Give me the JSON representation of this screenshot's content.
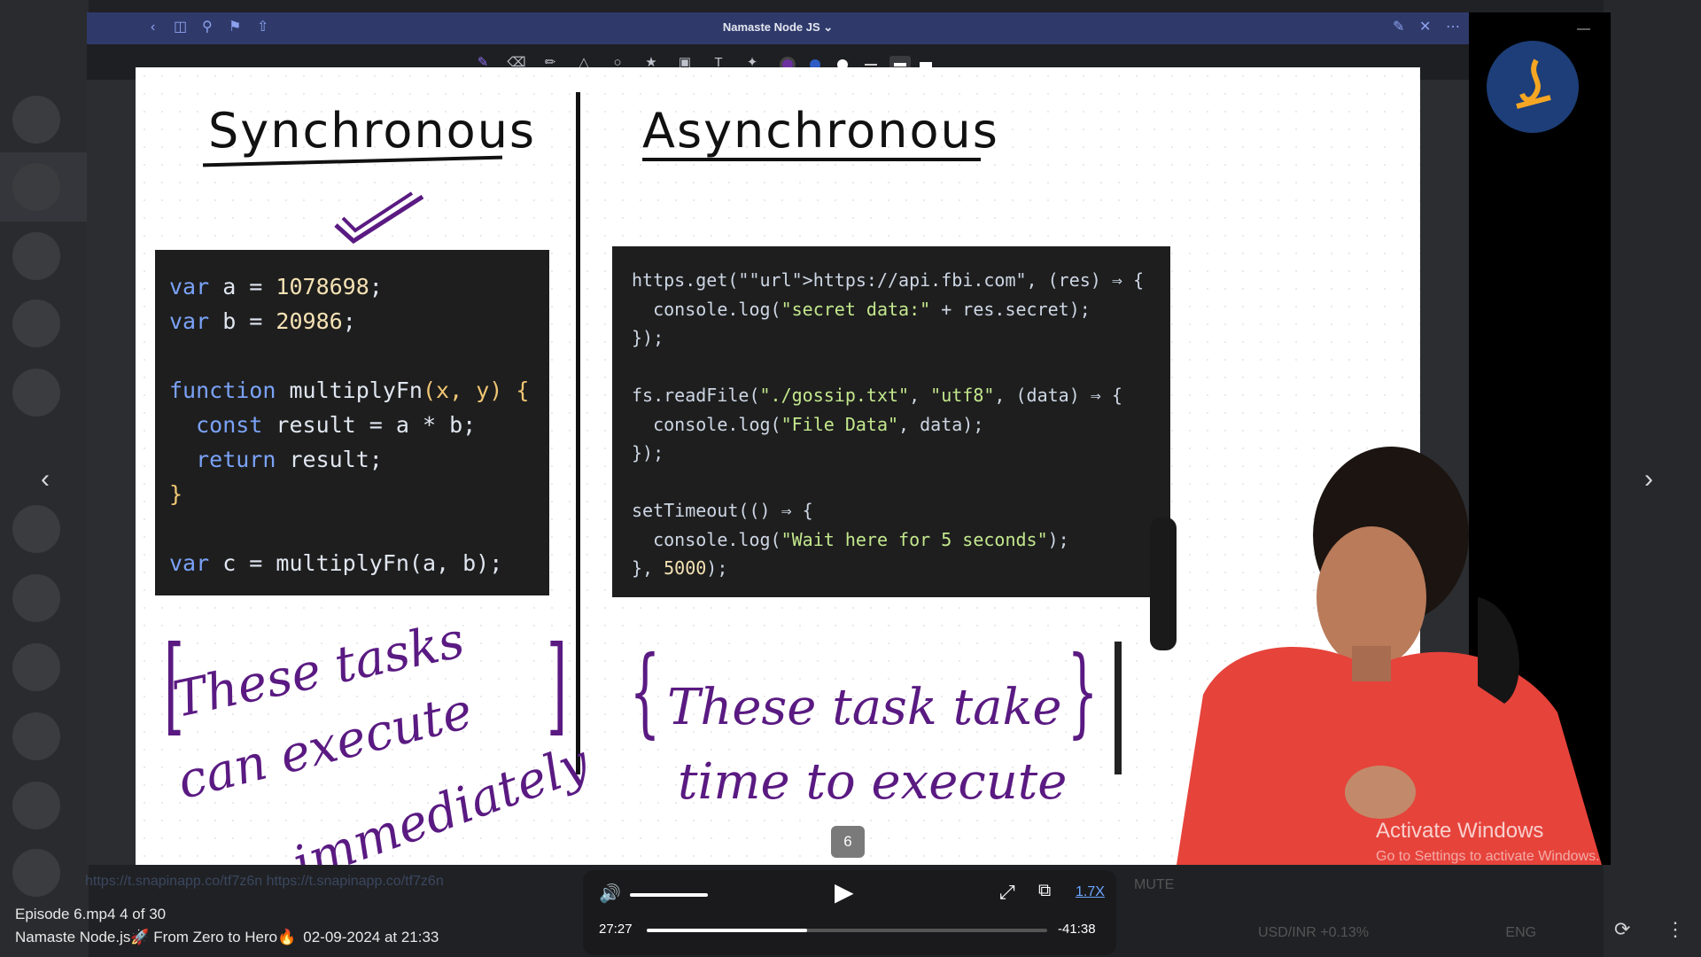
{
  "notes_app": {
    "title": "Namaste Node JS ⌄"
  },
  "slide": {
    "left_heading": "Synchronous",
    "right_heading": "Asynchronous",
    "sync_code": [
      [
        "var",
        " a = ",
        "1078698",
        ";"
      ],
      [
        "var",
        " b = ",
        "20986",
        ";"
      ],
      [
        "",
        "",
        "",
        ""
      ],
      [
        "function",
        " multiplyFn",
        "(x, y) {",
        ""
      ],
      [
        "  const",
        " result = a * b;",
        "",
        ""
      ],
      [
        "  return",
        " result;",
        "",
        ""
      ],
      [
        "}",
        "",
        "",
        ""
      ],
      [
        "",
        "",
        "",
        ""
      ],
      [
        "var",
        " c = multiplyFn(a, b);",
        "",
        ""
      ]
    ],
    "async_code": [
      "https.get(\"https://api.fbi.com\", (res) ⇒ {",
      "  console.log(\"secret data:\" + res.secret);",
      "});",
      "",
      "fs.readFile(\"./gossip.txt\", \"utf8\", (data) ⇒ {",
      "  console.log(\"File Data\", data);",
      "});",
      "",
      "setTimeout(() ⇒ {",
      "  console.log(\"Wait here for 5 seconds\");",
      "}, 5000);"
    ],
    "sync_note_1": "These tasks",
    "sync_note_2": "can execute",
    "sync_note_3": "immediately",
    "async_note_1": "These task take",
    "async_note_2": "time to execute",
    "page_number": "6"
  },
  "overlay": {
    "activate_title": "Activate Windows",
    "activate_sub": "Go to Settings to activate Windows."
  },
  "player": {
    "elapsed": "27:27",
    "remaining": "-41:38",
    "speed": "1.7X",
    "progress": 0.4
  },
  "media_info": {
    "file_line": "Episode 6.mp4 4 of 30",
    "course": "Namaste Node.js🚀 From Zero to Hero🔥",
    "timestamp": "02-09-2024 at 21:33"
  },
  "background": {
    "link_text": "https://t.snapinapp.co/tf7z6n https://t.snapinapp.co/tf7z6n",
    "mute_label": "MUTE",
    "ticker": "USD/INR +0.13%",
    "lang": "ENG"
  },
  "colors": {
    "titlebar": "#2f3a6b",
    "code_bg": "#1e1e1e",
    "ink_purple": "#5a1a82",
    "speed_accent": "#6ba6ff"
  }
}
